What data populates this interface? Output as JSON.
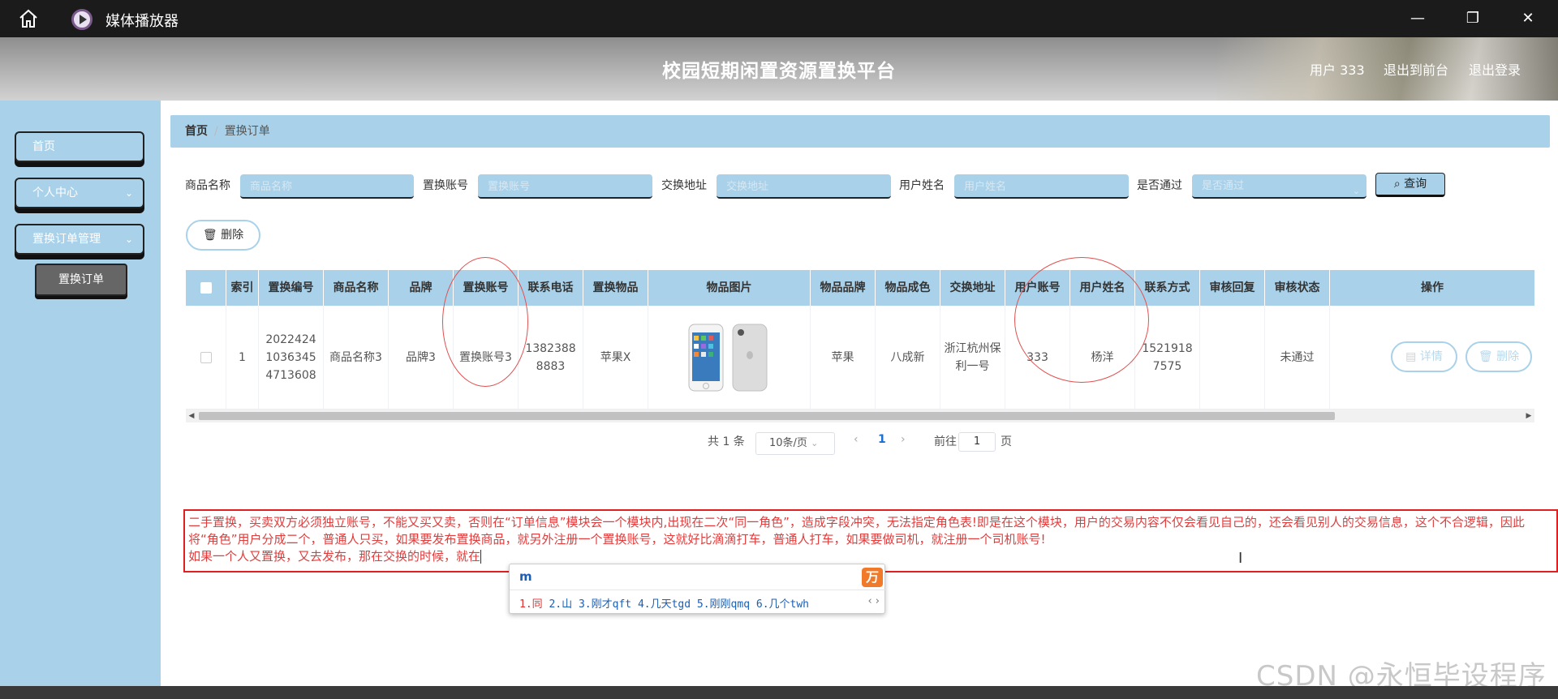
{
  "window": {
    "title": "媒体播放器",
    "minimize": "—",
    "maximize": "❐",
    "close": "✕"
  },
  "header": {
    "title": "校园短期闲置资源置换平台",
    "user": "用户 333",
    "exit_front": "退出到前台",
    "logout": "退出登录"
  },
  "sidebar": {
    "items": [
      {
        "label": "首页"
      },
      {
        "label": "个人中心",
        "chevron": "⌄"
      },
      {
        "label": "置换订单管理",
        "chevron": "⌄"
      }
    ],
    "sub_item": "置换订单"
  },
  "breadcrumb": {
    "home": "首页",
    "sep": "/",
    "current": "置换订单"
  },
  "filters": [
    {
      "label": "商品名称",
      "placeholder": "商品名称"
    },
    {
      "label": "置换账号",
      "placeholder": "置换账号"
    },
    {
      "label": "交换地址",
      "placeholder": "交换地址"
    },
    {
      "label": "用户姓名",
      "placeholder": "用户姓名"
    },
    {
      "label": "是否通过",
      "placeholder": "是否通过"
    }
  ],
  "search_button": "查询",
  "delete_button": "删除",
  "table": {
    "headers": [
      "索引",
      "置换编号",
      "商品名称",
      "品牌",
      "置换账号",
      "联系电话",
      "置换物品",
      "物品图片",
      "物品品牌",
      "物品成色",
      "交换地址",
      "用户账号",
      "用户姓名",
      "联系方式",
      "审核回复",
      "审核状态",
      "操作"
    ],
    "rows": [
      {
        "index": "1",
        "order_no": "20224241036345 4713608",
        "name": "商品名称3",
        "brand": "品牌3",
        "account": "置换账号3",
        "phone": "13823888883",
        "item": "苹果X",
        "item_brand": "苹果",
        "condition": "八成新",
        "address": "浙江杭州保利一号",
        "user_account": "333",
        "user_name": "杨洋",
        "contact": "15219187575",
        "reply": "",
        "status": "未通过",
        "detail_btn": "详情",
        "delete_btn": "删除"
      }
    ]
  },
  "pagination": {
    "total": "共 1 条",
    "page_size": "10条/页",
    "prev": "‹",
    "current": "1",
    "next": "›",
    "goto_prefix": "前往",
    "goto_value": "1",
    "goto_suffix": "页"
  },
  "note": {
    "line1": "二手置换，买卖双方必须独立账号，不能又买又卖，否则在“订单信息”模块会一个模块内,出现在二次“同一角色”，造成字段冲突，无法指定角色表!即是在这个模块，用户的交易内容不仅会看见自己的，还会看见别人的交易信息，这个不合逻辑，因此将“角色”用户分成二个，普通人只买，如果要发布置换商品，就另外注册一个置换账号，这就好比滴滴打车，普通人打车，如果要做司机，就注册一个司机账号!",
    "line2": "如果一个人又置换，又去发布，那在交换的时候，就在"
  },
  "ime": {
    "code": "m",
    "logo": "万",
    "candidates": [
      "1.同",
      "2.山",
      "3.刚才qft",
      "4.几天tgd",
      "5.刚刚qmq",
      "6.几个twh"
    ],
    "nav": "‹ ›"
  },
  "watermark": "CSDN @永恒毕设程序"
}
